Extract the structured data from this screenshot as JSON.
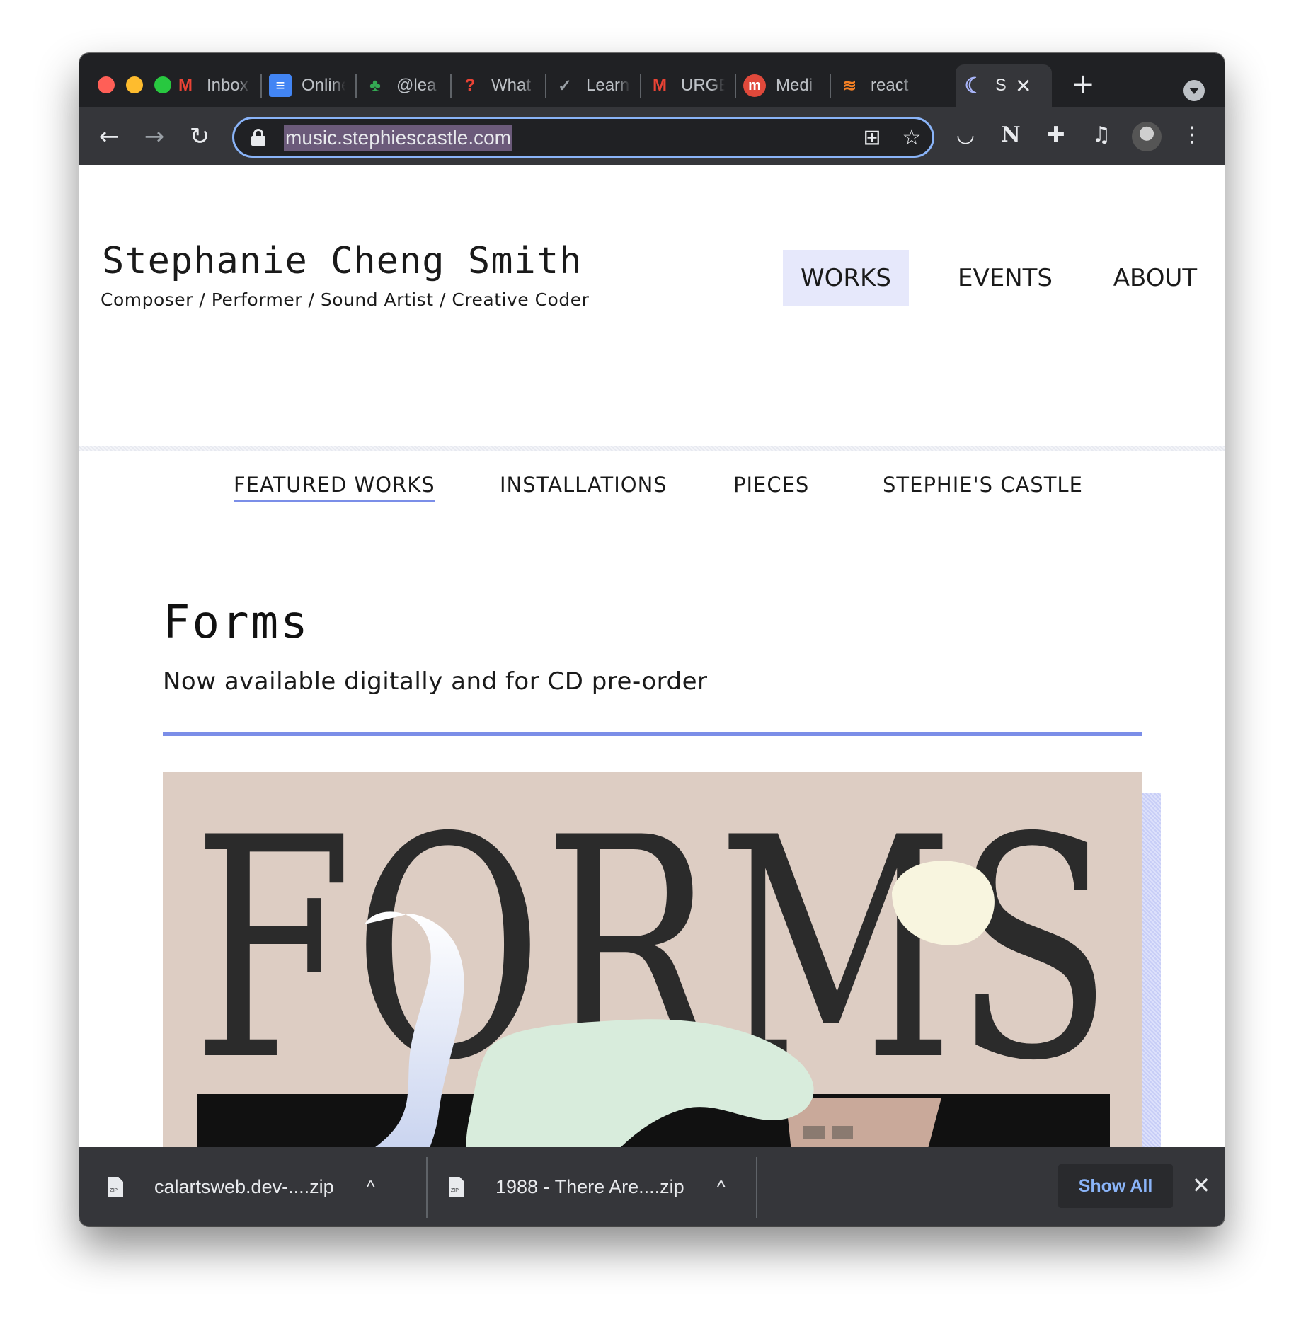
{
  "browser": {
    "tabs": [
      {
        "label": "Inbox",
        "favicon": "gmail-icon",
        "favicon_glyph": "M",
        "favicon_color": "#ea4335"
      },
      {
        "label": "Online",
        "favicon": "docs-icon",
        "favicon_glyph": "≡",
        "favicon_color": "#4285f4"
      },
      {
        "label": "@lea",
        "favicon": "trees-icon",
        "favicon_glyph": "♣",
        "favicon_color": "#34a853"
      },
      {
        "label": "What",
        "favicon": "question-icon",
        "favicon_glyph": "?",
        "favicon_color": "#ea4335"
      },
      {
        "label": "Learn",
        "favicon": "check-icon",
        "favicon_glyph": "✓",
        "favicon_color": "#9aa0a6"
      },
      {
        "label": "URGE",
        "favicon": "gmail-icon",
        "favicon_glyph": "M",
        "favicon_color": "#ea4335"
      },
      {
        "label": "Medi",
        "favicon": "medium-icon",
        "favicon_glyph": "m",
        "favicon_color": "#e8eaed"
      },
      {
        "label": "react",
        "favicon": "stackoverflow-icon",
        "favicon_glyph": "≋",
        "favicon_color": "#f48024"
      },
      {
        "label": "S",
        "favicon": "moon-icon",
        "favicon_glyph": "☾",
        "favicon_color": "#a8b4f8",
        "active": true
      }
    ],
    "url": "music.stephiescastle.com",
    "close_tab_glyph": "✕",
    "new_tab_glyph": "+"
  },
  "site": {
    "title": "Stephanie Cheng Smith",
    "subtitle": "Composer / Performer / Sound Artist / Creative Coder",
    "nav": {
      "works": "WORKS",
      "events": "EVENTS",
      "about": "ABOUT"
    },
    "subnav": {
      "featured": "FEATURED WORKS",
      "installations": "INSTALLATIONS",
      "pieces": "PIECES",
      "castle": "STEPHIE'S CASTLE"
    },
    "feature": {
      "title": "Forms",
      "subtitle": "Now available digitally and for CD pre-order",
      "cover_text": "FORMS"
    },
    "colors": {
      "accent": "#7b8ee8",
      "nav_active_bg": "#e6e8fb",
      "cover_bg": "#ddcdc3"
    }
  },
  "downloads": {
    "items": [
      {
        "name": "calartsweb.dev-....zip"
      },
      {
        "name": "1988 - There Are....zip"
      }
    ],
    "show_all": "Show All",
    "close_glyph": "✕",
    "chevron_glyph": "^"
  }
}
